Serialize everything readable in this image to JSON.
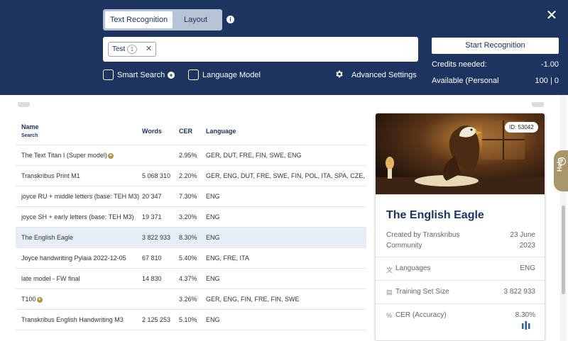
{
  "header": {
    "tabs": [
      {
        "label": "Text Recognition",
        "active": true
      },
      {
        "label": "Layout",
        "active": false
      }
    ],
    "selected_model_chip": {
      "label": "Test",
      "count": "1"
    },
    "options": {
      "smart_search": "Smart Search",
      "language_model": "Language Model",
      "advanced_settings": "Advanced Settings"
    },
    "start_button": "Start Recognition",
    "credits_needed_label": "Credits needed:",
    "credits_needed_value": "-1.00",
    "available_label": "Available (Personal",
    "available_value": "100 | 0"
  },
  "table": {
    "columns": {
      "name": "Name",
      "name_sub": "Search",
      "words": "Words",
      "cer": "CER",
      "language": "Language"
    },
    "rows": [
      {
        "name": "The Text Titan I (Super model)",
        "words": "",
        "cer": "2.95%",
        "language": "GER, DUT, FRE, FIN, SWE, ENG",
        "badge": true,
        "selected": false
      },
      {
        "name": "Transkribus Print M1",
        "words": "5 068 310",
        "cer": "2.20%",
        "language": "GER, ENG, DUT, FRE, SWE, FIN, POL, ITA, SPA, CZE, SLO, SLO",
        "badge": false,
        "selected": false
      },
      {
        "name": "joyce RU + middle letters (base: TEH M3)",
        "words": "20 347",
        "cer": "7.30%",
        "language": "ENG",
        "badge": false,
        "selected": false
      },
      {
        "name": "joyce SH + early letters (base: TEH M3)",
        "words": "19 371",
        "cer": "3.20%",
        "language": "ENG",
        "badge": false,
        "selected": false
      },
      {
        "name": "The English Eagle",
        "words": "3 822 933",
        "cer": "8.30%",
        "language": "ENG",
        "badge": false,
        "selected": true
      },
      {
        "name": "Joyce handwriting Pylaia 2022-12-05",
        "words": "67 810",
        "cer": "5.40%",
        "language": "ENG, FRE, ITA",
        "badge": false,
        "selected": false
      },
      {
        "name": "late model - FW final",
        "words": "14 830",
        "cer": "4.37%",
        "language": "ENG",
        "badge": false,
        "selected": false
      },
      {
        "name": "T100",
        "words": "",
        "cer": "3.26%",
        "language": "GER, ENG, FIN, FRE, FIN, SWE",
        "badge": true,
        "selected": false
      },
      {
        "name": "Transkribus English Handwriting M3",
        "words": "2 125 253",
        "cer": "5.10%",
        "language": "ENG",
        "badge": false,
        "selected": false
      }
    ]
  },
  "detail": {
    "id_badge": "ID: 53042",
    "title": "The English Eagle",
    "creator_line1": "Created by Transkribus",
    "creator_line2": "Community",
    "date_line1": "23 June",
    "date_line2": "2023",
    "languages_label": "Languages",
    "languages_value": "ENG",
    "training_label": "Training Set Size",
    "training_value": "3 822 933",
    "cer_label": "CER (Accuracy)",
    "cer_value": "8.30%"
  },
  "help_label": "Help",
  "colors": {
    "header_bg": "#1d3461",
    "accent_gold": "#a8956a",
    "selected_row": "#e8eef8"
  }
}
